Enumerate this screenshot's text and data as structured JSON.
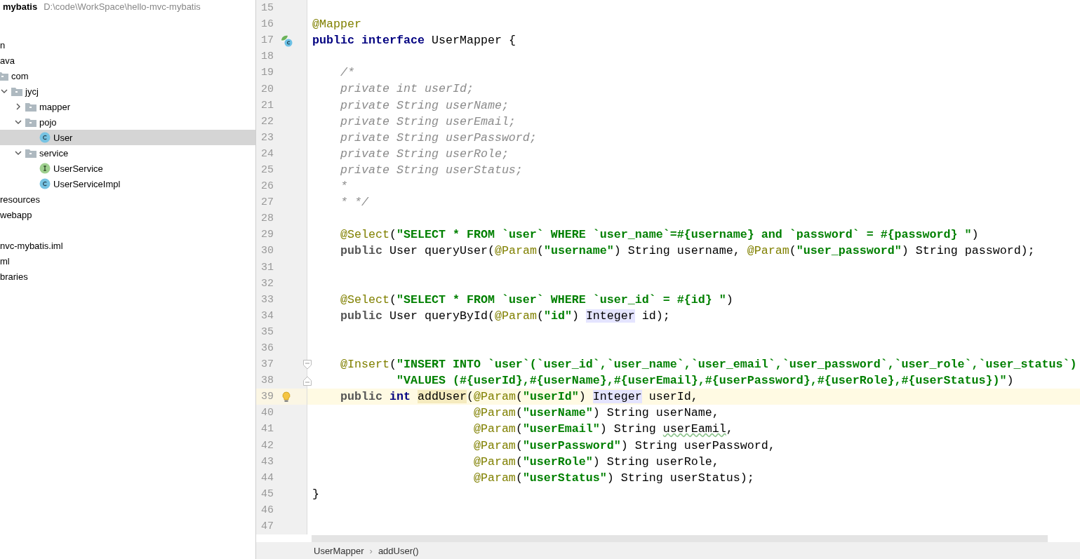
{
  "project": {
    "name": "mybatis",
    "path": "D:\\code\\WorkSpace\\hello-mvc-mybatis"
  },
  "tree": [
    {
      "label": "n",
      "kind": "text",
      "selected": false
    },
    {
      "label": "ava",
      "kind": "text",
      "selected": false
    },
    {
      "label": "com",
      "kind": "package",
      "selected": false,
      "children": [
        {
          "label": "jycj",
          "kind": "package",
          "expanded": true,
          "selected": false,
          "children": [
            {
              "label": "mapper",
              "kind": "package",
              "expanded": false,
              "selected": false
            },
            {
              "label": "pojo",
              "kind": "package",
              "expanded": true,
              "selected": false,
              "children": [
                {
                  "label": "User",
                  "kind": "class",
                  "selected": true
                }
              ]
            },
            {
              "label": "service",
              "kind": "package",
              "expanded": true,
              "selected": false,
              "children": [
                {
                  "label": "UserService",
                  "kind": "interface",
                  "selected": false
                },
                {
                  "label": "UserServiceImpl",
                  "kind": "class",
                  "selected": false
                }
              ]
            }
          ]
        }
      ]
    },
    {
      "label": "resources",
      "kind": "text",
      "selected": false
    },
    {
      "label": "webapp",
      "kind": "text",
      "selected": false
    },
    {
      "kind": "blank"
    },
    {
      "label": "nvc-mybatis.iml",
      "kind": "text",
      "selected": false
    },
    {
      "label": "ml",
      "kind": "text",
      "selected": false
    },
    {
      "label": "braries",
      "kind": "text",
      "selected": false
    }
  ],
  "editor": {
    "lines": [
      {
        "n": "15",
        "current": false
      },
      {
        "n": "16",
        "current": false,
        "tokens": [
          {
            "kind": "ann",
            "text": "@Mapper"
          }
        ]
      },
      {
        "n": "17",
        "current": false,
        "kind": "bean",
        "tokens": [
          {
            "kind": "kw",
            "text": "public interface"
          },
          {
            "kind": "plain",
            "text": " UserMapper {"
          }
        ]
      },
      {
        "n": "18",
        "current": false
      },
      {
        "n": "19",
        "current": false,
        "tokens": [
          {
            "kind": "comment",
            "text": "    /*"
          }
        ]
      },
      {
        "n": "20",
        "current": false,
        "tokens": [
          {
            "kind": "comment",
            "text": "    private int userId;"
          }
        ]
      },
      {
        "n": "21",
        "current": false,
        "tokens": [
          {
            "kind": "comment",
            "text": "    private String userName;"
          }
        ]
      },
      {
        "n": "22",
        "current": false,
        "tokens": [
          {
            "kind": "comment",
            "text": "    private String userEmail;"
          }
        ]
      },
      {
        "n": "23",
        "current": false,
        "tokens": [
          {
            "kind": "comment",
            "text": "    private String userPassword;"
          }
        ]
      },
      {
        "n": "24",
        "current": false,
        "tokens": [
          {
            "kind": "comment",
            "text": "    private String userRole;"
          }
        ]
      },
      {
        "n": "25",
        "current": false,
        "tokens": [
          {
            "kind": "comment",
            "text": "    private String userStatus;"
          }
        ]
      },
      {
        "n": "26",
        "current": false,
        "tokens": [
          {
            "kind": "comment",
            "text": "    *"
          }
        ]
      },
      {
        "n": "27",
        "current": false,
        "tokens": [
          {
            "kind": "comment",
            "text": "    * */"
          }
        ]
      },
      {
        "n": "28",
        "current": false
      },
      {
        "n": "29",
        "current": false,
        "tokens": [
          {
            "kind": "ann",
            "text": "    @Select"
          },
          {
            "kind": "plain",
            "text": "("
          },
          {
            "kind": "str",
            "text": "\"SELECT * FROM `user` WHERE `user_name`=#{username} and `password` = #{password} \""
          },
          {
            "kind": "plain",
            "text": ")"
          }
        ]
      },
      {
        "n": "30",
        "current": false,
        "tokens": [
          {
            "kind": "mod",
            "text": "    public"
          },
          {
            "kind": "plain",
            "text": " User queryUser("
          },
          {
            "kind": "ann",
            "text": "@Param"
          },
          {
            "kind": "plain",
            "text": "("
          },
          {
            "kind": "str",
            "text": "\"username\""
          },
          {
            "kind": "plain",
            "text": ") String username, "
          },
          {
            "kind": "ann",
            "text": "@Param"
          },
          {
            "kind": "plain",
            "text": "("
          },
          {
            "kind": "str",
            "text": "\"user_password\""
          },
          {
            "kind": "plain",
            "text": ") String password);"
          }
        ]
      },
      {
        "n": "31",
        "current": false
      },
      {
        "n": "32",
        "current": false
      },
      {
        "n": "33",
        "current": false,
        "tokens": [
          {
            "kind": "ann",
            "text": "    @Select"
          },
          {
            "kind": "plain",
            "text": "("
          },
          {
            "kind": "str",
            "text": "\"SELECT * FROM `user` WHERE `user_id` = #{id} \""
          },
          {
            "kind": "plain",
            "text": ")"
          }
        ]
      },
      {
        "n": "34",
        "current": false,
        "tokens": [
          {
            "kind": "mod",
            "text": "    public"
          },
          {
            "kind": "plain",
            "text": " User queryById("
          },
          {
            "kind": "ann",
            "text": "@Param"
          },
          {
            "kind": "plain",
            "text": "("
          },
          {
            "kind": "str",
            "text": "\"id\""
          },
          {
            "kind": "plain",
            "text": ") "
          },
          {
            "kind": "usage",
            "text": "Integer"
          },
          {
            "kind": "plain",
            "text": " id);"
          }
        ]
      },
      {
        "n": "35",
        "current": false
      },
      {
        "n": "36",
        "current": false
      },
      {
        "n": "37",
        "current": false,
        "kind": "fold-start",
        "tokens": [
          {
            "kind": "ann",
            "text": "    @Insert"
          },
          {
            "kind": "plain",
            "text": "("
          },
          {
            "kind": "str",
            "text": "\"INSERT INTO `user`(`user_id`,`user_name`,`user_email`,`user_password`,`user_role`,`user_status`)"
          }
        ]
      },
      {
        "n": "38",
        "current": false,
        "kind": "fold-end",
        "tokens": [
          {
            "kind": "str",
            "text": "            \"VALUES (#{userId},#{userName},#{userEmail},#{userPassword},#{userRole},#{userStatus})\""
          },
          {
            "kind": "plain",
            "text": ")"
          }
        ]
      },
      {
        "n": "39",
        "current": true,
        "kind": "bulb",
        "tokens": [
          {
            "kind": "mod",
            "text": "    public "
          },
          {
            "kind": "kw",
            "text": "int "
          },
          {
            "kind": "caret",
            "text": "addUser"
          },
          {
            "kind": "plain",
            "text": "("
          },
          {
            "kind": "ann",
            "text": "@Param"
          },
          {
            "kind": "plain",
            "text": "("
          },
          {
            "kind": "str",
            "text": "\"userId\""
          },
          {
            "kind": "plain",
            "text": ") "
          },
          {
            "kind": "usage",
            "text": "Integer"
          },
          {
            "kind": "plain",
            "text": " userId,"
          }
        ]
      },
      {
        "n": "40",
        "current": false,
        "tokens": [
          {
            "kind": "ann",
            "text": "                       @Param"
          },
          {
            "kind": "plain",
            "text": "("
          },
          {
            "kind": "str",
            "text": "\"userName\""
          },
          {
            "kind": "plain",
            "text": ") String userName,"
          }
        ]
      },
      {
        "n": "41",
        "current": false,
        "tokens": [
          {
            "kind": "ann",
            "text": "                       @Param"
          },
          {
            "kind": "plain",
            "text": "("
          },
          {
            "kind": "str",
            "text": "\"userEmail\""
          },
          {
            "kind": "plain",
            "text": ") String "
          },
          {
            "kind": "typo",
            "text": "userEamil"
          },
          {
            "kind": "plain",
            "text": ","
          }
        ]
      },
      {
        "n": "42",
        "current": false,
        "tokens": [
          {
            "kind": "ann",
            "text": "                       @Param"
          },
          {
            "kind": "plain",
            "text": "("
          },
          {
            "kind": "str",
            "text": "\"userPassword\""
          },
          {
            "kind": "plain",
            "text": ") String userPassword,"
          }
        ]
      },
      {
        "n": "43",
        "current": false,
        "tokens": [
          {
            "kind": "ann",
            "text": "                       @Param"
          },
          {
            "kind": "plain",
            "text": "("
          },
          {
            "kind": "str",
            "text": "\"userRole\""
          },
          {
            "kind": "plain",
            "text": ") String userRole,"
          }
        ]
      },
      {
        "n": "44",
        "current": false,
        "tokens": [
          {
            "kind": "ann",
            "text": "                       @Param"
          },
          {
            "kind": "plain",
            "text": "("
          },
          {
            "kind": "str",
            "text": "\"userStatus\""
          },
          {
            "kind": "plain",
            "text": ") String userStatus);"
          }
        ]
      },
      {
        "n": "45",
        "current": false,
        "tokens": [
          {
            "kind": "plain",
            "text": "}"
          }
        ]
      },
      {
        "n": "46",
        "current": false
      },
      {
        "n": "47",
        "current": false
      }
    ]
  },
  "breadcrumbs": {
    "items": [
      "UserMapper",
      "addUser()"
    ],
    "separator": "›"
  }
}
